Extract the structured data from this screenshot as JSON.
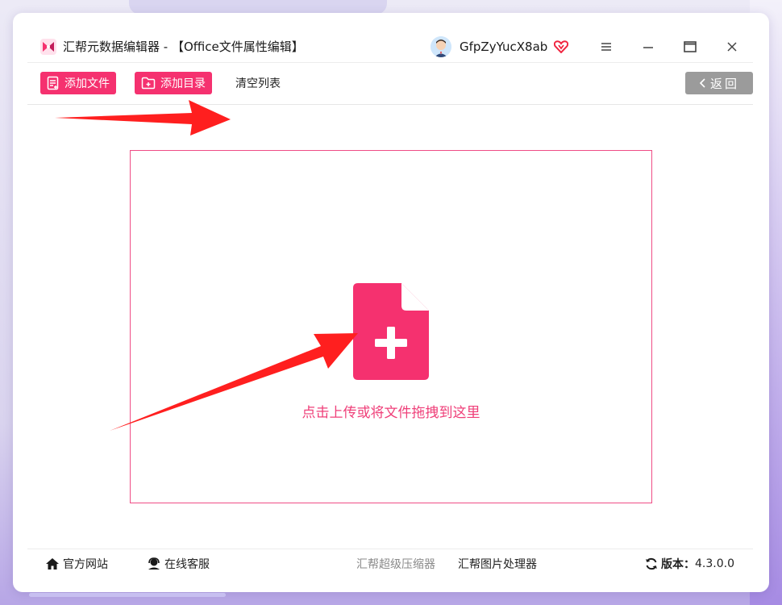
{
  "window": {
    "app_title": "汇帮元数据编辑器 - 【Office文件属性编辑】",
    "username": "GfpZyYucX8ab"
  },
  "toolbar": {
    "add_file_label": "添加文件",
    "add_folder_label": "添加目录",
    "clear_list_label": "清空列表",
    "back_label": "返回"
  },
  "drop_zone": {
    "hint": "点击上传或将文件拖拽到这里"
  },
  "footer": {
    "official_site": "官方网站",
    "online_service": "在线客服",
    "compressor_link": "汇帮超级压缩器",
    "image_processor_link": "汇帮图片处理器",
    "version_label": "版本：",
    "version_value": "4.3.0.0"
  },
  "colors": {
    "accent": "#f5316f",
    "drop_border": "#ef4d86",
    "arrow": "#ff1f1f",
    "back_button": "#9b9b9b"
  },
  "icons": [
    "app-logo-icon",
    "avatar-icon",
    "vip-heart-icon",
    "menu-icon",
    "minimize-icon",
    "maximize-icon",
    "close-icon",
    "add-file-icon",
    "add-folder-icon",
    "chevron-left-icon",
    "file-plus-icon",
    "home-icon",
    "headset-icon",
    "refresh-icon"
  ]
}
